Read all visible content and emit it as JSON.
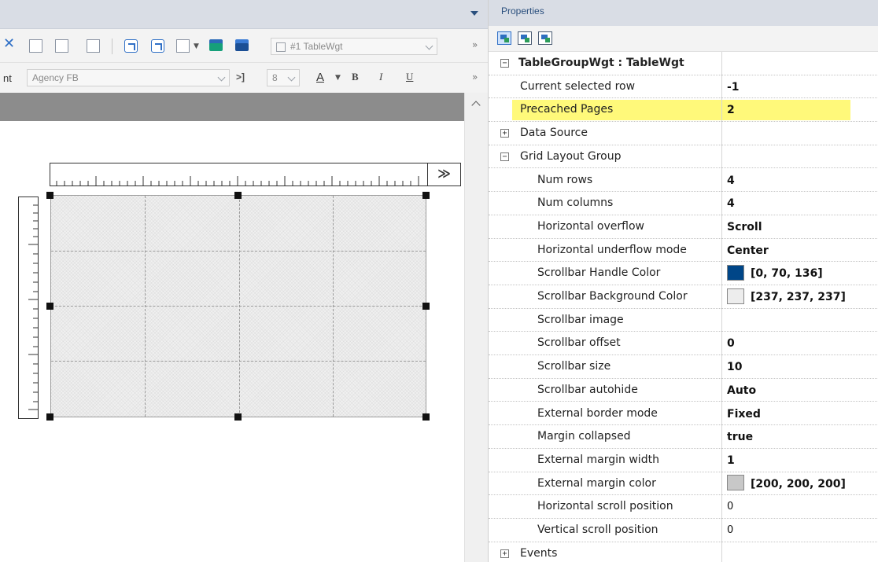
{
  "toolbar": {
    "widget_combo": "#1 TableWgt",
    "font_label": "nt",
    "font_combo": "Agency FB",
    "size_combo": "8",
    "font_color_btn": "A",
    "bold_btn": "B",
    "italic_btn": "I",
    "underline_btn": "U",
    "more": "»",
    "align_btn": ">]"
  },
  "designer": {
    "ruler_expand": "≫"
  },
  "properties": {
    "title": "Properties",
    "rows": [
      {
        "kind": "header",
        "expander": "−",
        "name": "TableGroupWgt : TableWgt",
        "value": ""
      },
      {
        "kind": "prop",
        "name": "Current selected row",
        "value": "-1"
      },
      {
        "kind": "prop",
        "name": "Precached Pages",
        "value": "2",
        "highlight": true
      },
      {
        "kind": "cat",
        "expander": "+",
        "name": "Data Source",
        "value": ""
      },
      {
        "kind": "cat",
        "expander": "−",
        "name": "Grid Layout Group",
        "value": ""
      },
      {
        "kind": "sub",
        "name": "Num rows",
        "value": "4"
      },
      {
        "kind": "sub",
        "name": "Num columns",
        "value": "4"
      },
      {
        "kind": "sub",
        "name": "Horizontal overflow",
        "value": "Scroll"
      },
      {
        "kind": "sub",
        "name": "Horizontal underflow mode",
        "value": "Center"
      },
      {
        "kind": "sub",
        "name": "Scrollbar Handle Color",
        "value": "[0, 70, 136]",
        "swatch": "#004688"
      },
      {
        "kind": "sub",
        "name": "Scrollbar Background Color",
        "value": "[237, 237, 237]",
        "swatch": "#ededed"
      },
      {
        "kind": "sub",
        "name": "Scrollbar image",
        "value": ""
      },
      {
        "kind": "sub",
        "name": "Scrollbar offset",
        "value": "0"
      },
      {
        "kind": "sub",
        "name": "Scrollbar size",
        "value": "10"
      },
      {
        "kind": "sub",
        "name": "Scrollbar autohide",
        "value": "Auto"
      },
      {
        "kind": "sub",
        "name": "External border mode",
        "value": "Fixed"
      },
      {
        "kind": "sub",
        "name": "Margin collapsed",
        "value": "true"
      },
      {
        "kind": "sub",
        "name": "External margin width",
        "value": "1"
      },
      {
        "kind": "sub",
        "name": "External margin color",
        "value": "[200, 200, 200]",
        "swatch": "#c8c8c8"
      },
      {
        "kind": "sub",
        "name": "Horizontal scroll position",
        "value": "0",
        "plain": true
      },
      {
        "kind": "sub",
        "name": "Vertical scroll position",
        "value": "0",
        "plain": true
      },
      {
        "kind": "cat",
        "expander": "+",
        "name": "Events",
        "value": ""
      }
    ]
  },
  "colors": {
    "highlight": "#fff97a",
    "header_bar": "#d9dde5",
    "title_text": "#2a4f7d"
  }
}
